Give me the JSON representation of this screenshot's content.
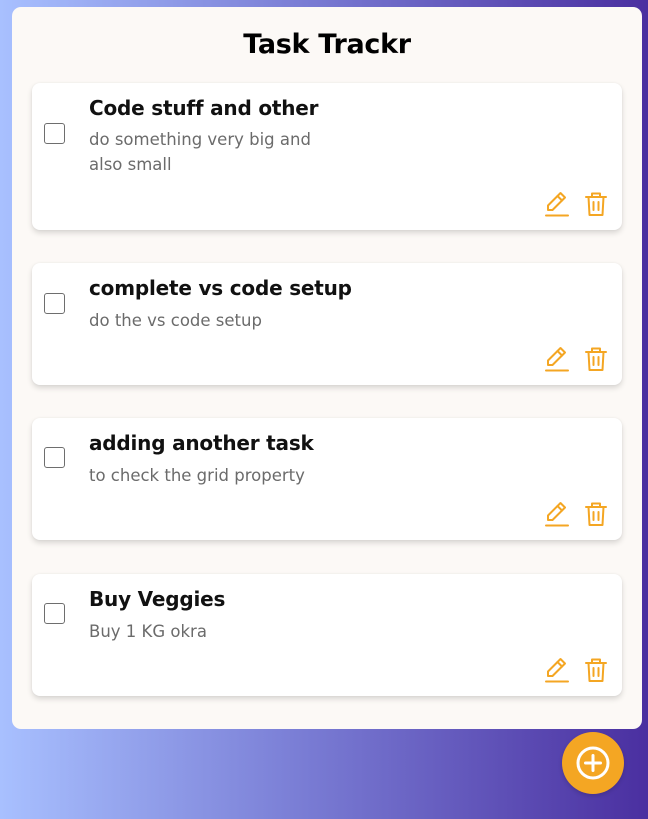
{
  "app": {
    "title": "Task Trackr"
  },
  "tasks": [
    {
      "title": "Code stuff and other",
      "description_lines": [
        "do something very big and",
        "also small"
      ],
      "completed": false
    },
    {
      "title": "complete vs code setup",
      "description_lines": [
        "do the vs code setup"
      ],
      "completed": false
    },
    {
      "title": "adding another task",
      "description_lines": [
        "to check the grid property"
      ],
      "completed": false
    },
    {
      "title": "Buy Veggies",
      "description_lines": [
        "Buy 1 KG okra"
      ],
      "completed": false
    }
  ],
  "icons": {
    "edit": "pencil-edit-icon",
    "delete": "trash-icon",
    "add": "plus-circle-icon"
  },
  "colors": {
    "accent": "#f4a623",
    "panel_bg": "#fcf9f6",
    "card_bg": "#ffffff",
    "gradient_start": "#a8c0ff",
    "gradient_end": "#4a2fa0"
  }
}
